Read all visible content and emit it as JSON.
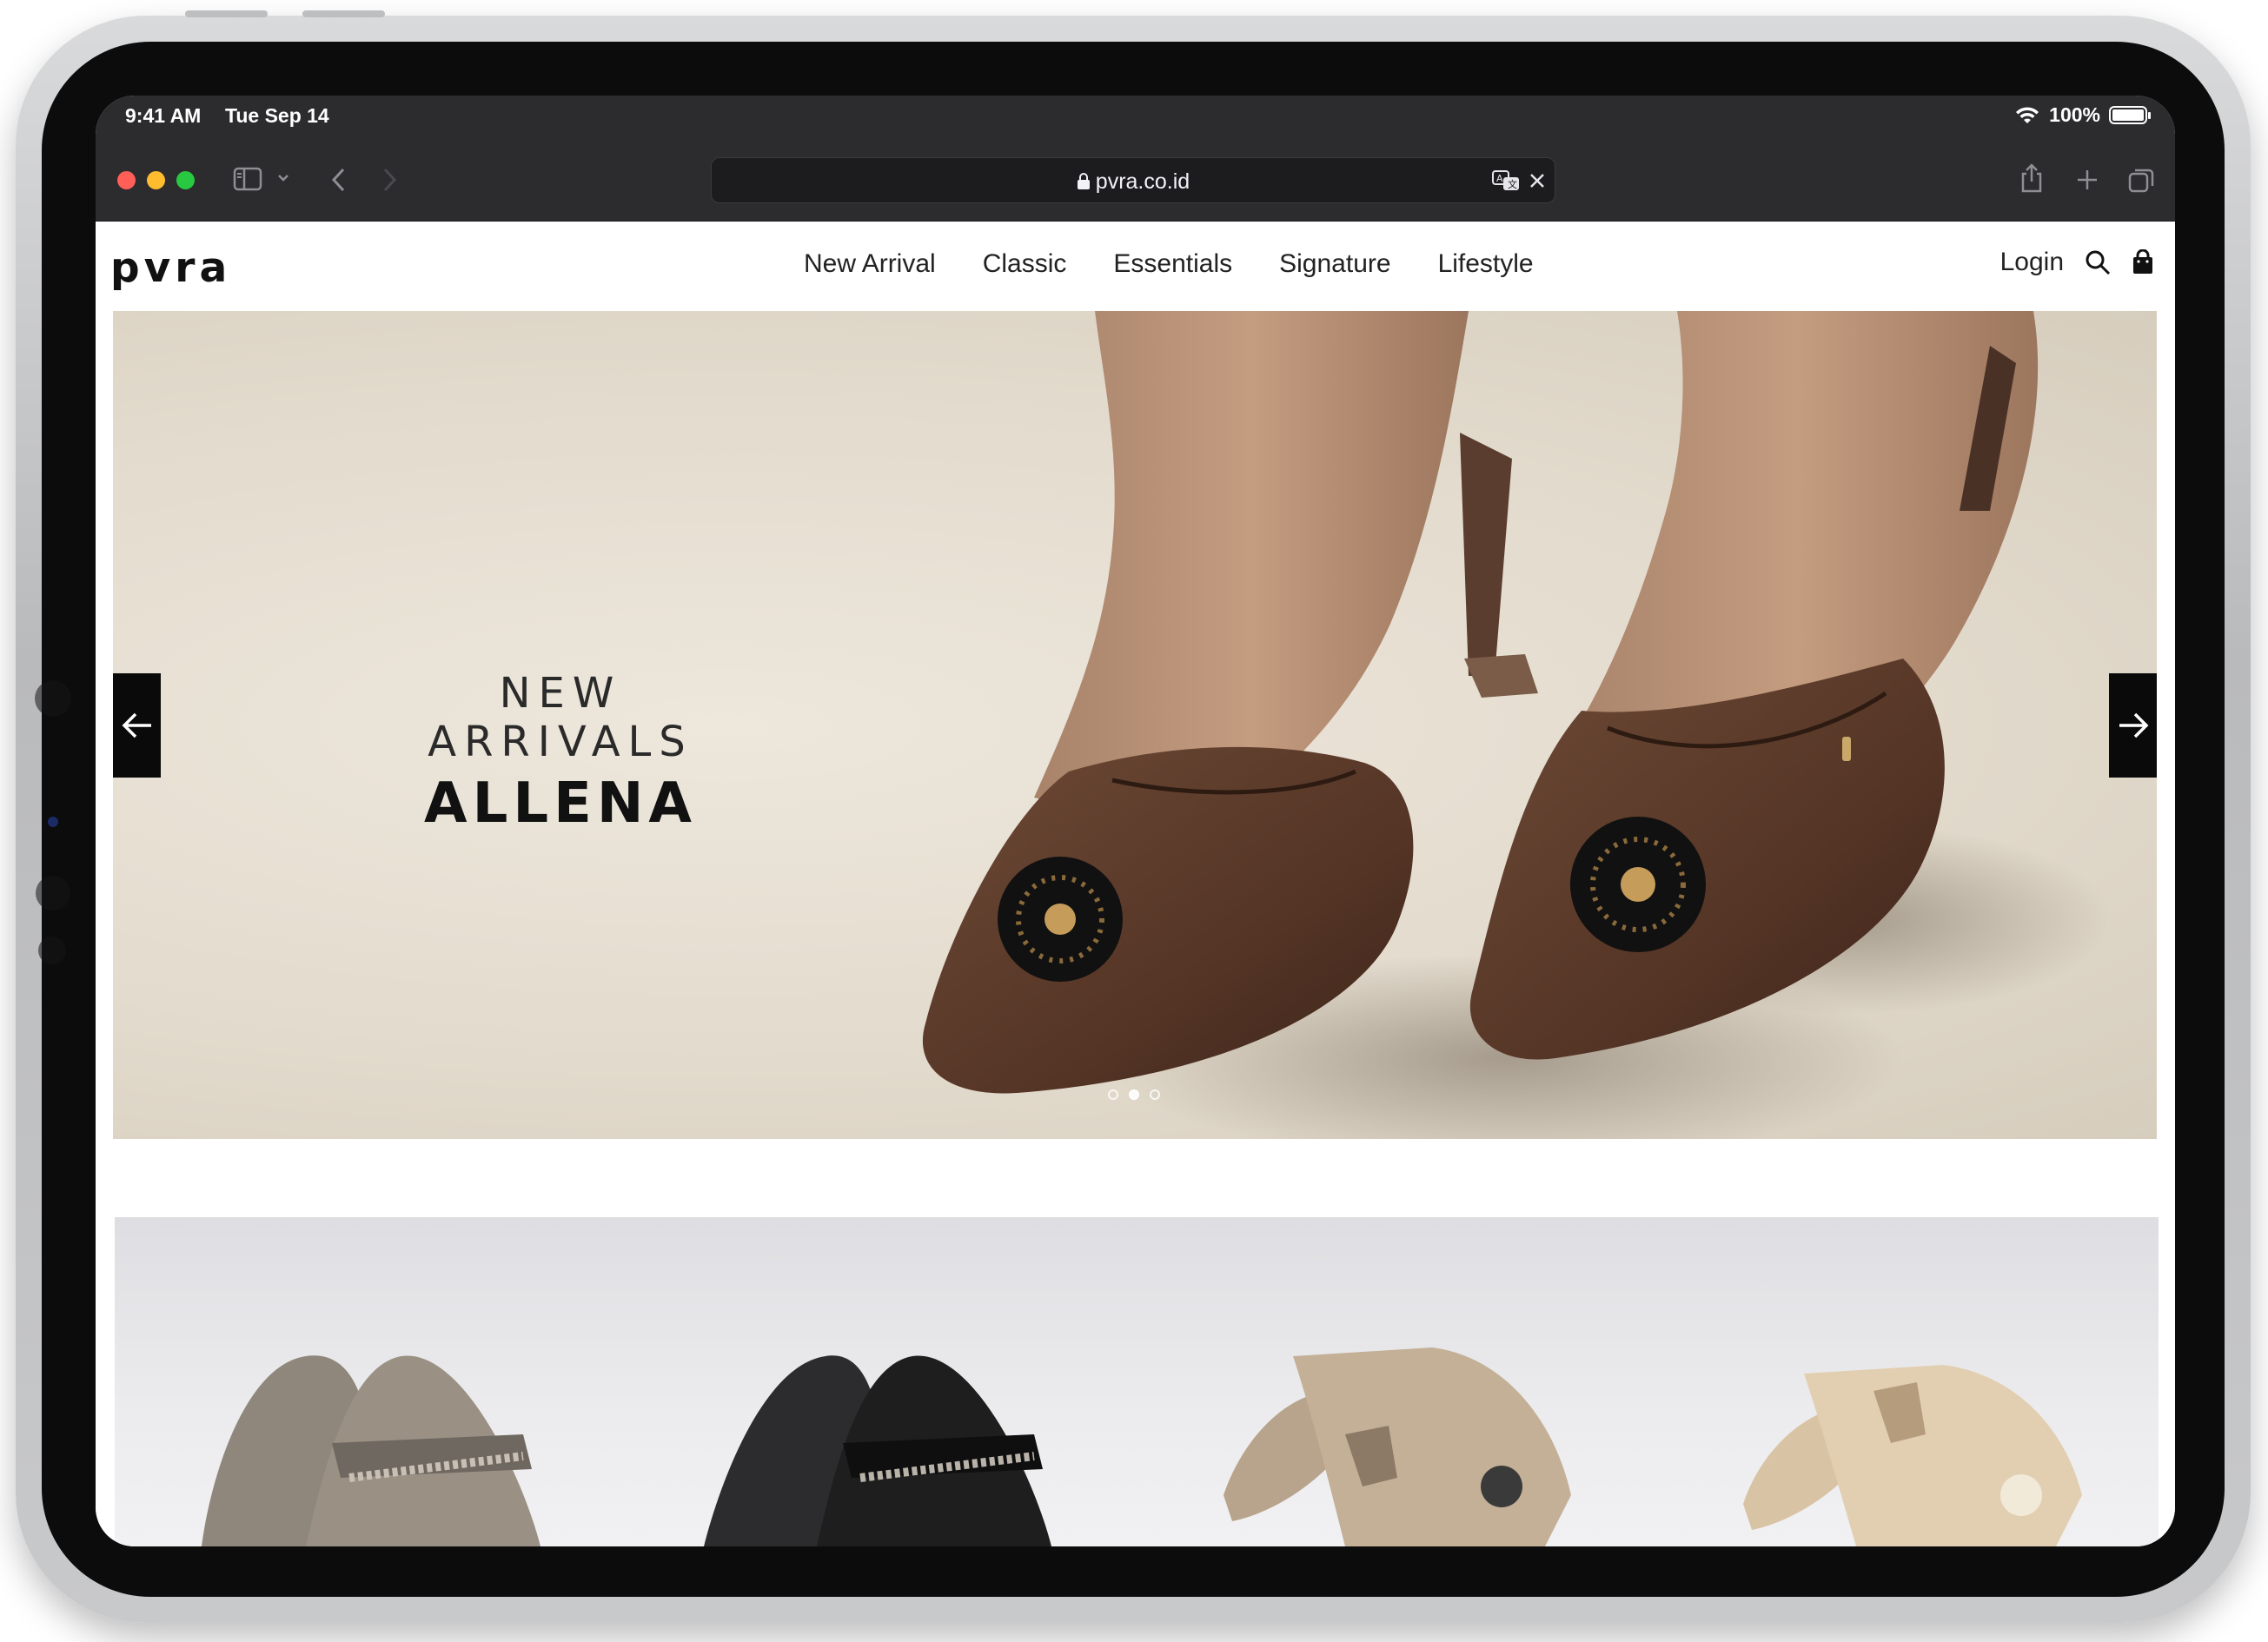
{
  "status_bar": {
    "time": "9:41 AM",
    "date": "Tue Sep 14",
    "battery": "100%"
  },
  "browser": {
    "url": "pvra.co.id"
  },
  "site": {
    "logo": "pvra",
    "nav": [
      "New Arrival",
      "Classic",
      "Essentials",
      "Signature",
      "Lifestyle"
    ],
    "login": "Login"
  },
  "hero": {
    "subtitle": "NEW ARRIVALS",
    "title": "ALLENA",
    "slide_count": 3,
    "active_slide": 2
  },
  "products": [
    {
      "name": "",
      "color": "#8f877c"
    },
    {
      "name": "",
      "color": "#1e1e1e"
    },
    {
      "name": "",
      "color": "#b8a48c"
    },
    {
      "name": "",
      "color": "#d8c3a4"
    }
  ],
  "colors": {
    "browser_chrome": "#2c2c2e",
    "close": "#ff5f57",
    "minimize": "#febc2e",
    "zoom": "#28c840",
    "nav_arrow_bg": "#0a0a0a"
  }
}
